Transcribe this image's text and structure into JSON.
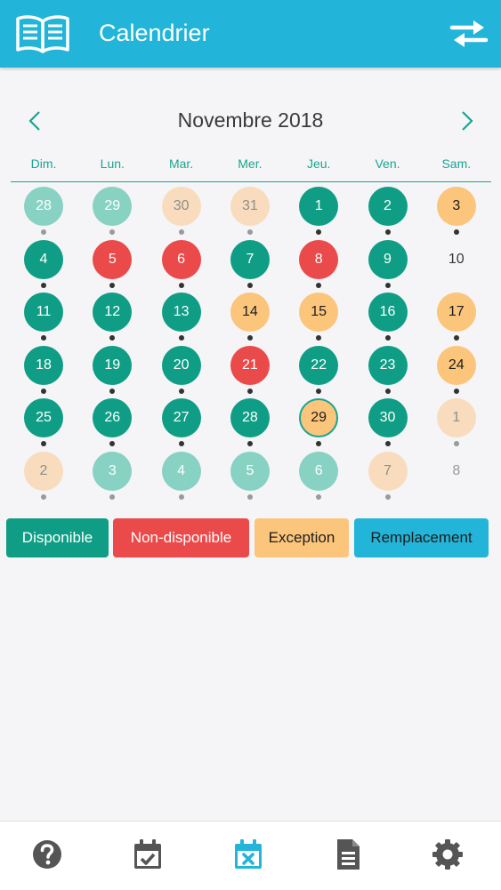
{
  "header": {
    "title": "Calendrier",
    "logo_icon": "open-book-icon",
    "action_icon": "swap-arrows-icon"
  },
  "calendar": {
    "month_title": "Novembre 2018",
    "prev_icon": "chevron-left-icon",
    "next_icon": "chevron-right-icon",
    "weekdays": [
      "Dim.",
      "Lun.",
      "Mar.",
      "Mer.",
      "Jeu.",
      "Ven.",
      "Sam."
    ],
    "weeks": [
      [
        {
          "day": "28",
          "status": "disp",
          "faded": true,
          "dot": true
        },
        {
          "day": "29",
          "status": "disp",
          "faded": true,
          "dot": true
        },
        {
          "day": "30",
          "status": "exc",
          "faded": true,
          "dot": true
        },
        {
          "day": "31",
          "status": "exc",
          "faded": true,
          "dot": true
        },
        {
          "day": "1",
          "status": "disp",
          "faded": false,
          "dot": true
        },
        {
          "day": "2",
          "status": "disp",
          "faded": false,
          "dot": true
        },
        {
          "day": "3",
          "status": "exc",
          "faded": false,
          "dot": true
        }
      ],
      [
        {
          "day": "4",
          "status": "disp",
          "faded": false,
          "dot": true
        },
        {
          "day": "5",
          "status": "indisp",
          "faded": false,
          "dot": true
        },
        {
          "day": "6",
          "status": "indisp",
          "faded": false,
          "dot": true
        },
        {
          "day": "7",
          "status": "disp",
          "faded": false,
          "dot": true
        },
        {
          "day": "8",
          "status": "indisp",
          "faded": false,
          "dot": true
        },
        {
          "day": "9",
          "status": "disp",
          "faded": false,
          "dot": true
        },
        {
          "day": "10",
          "status": "none",
          "faded": false,
          "dot": false
        }
      ],
      [
        {
          "day": "11",
          "status": "disp",
          "faded": false,
          "dot": true
        },
        {
          "day": "12",
          "status": "disp",
          "faded": false,
          "dot": true
        },
        {
          "day": "13",
          "status": "disp",
          "faded": false,
          "dot": true
        },
        {
          "day": "14",
          "status": "exc",
          "faded": false,
          "dot": true
        },
        {
          "day": "15",
          "status": "exc",
          "faded": false,
          "dot": true
        },
        {
          "day": "16",
          "status": "disp",
          "faded": false,
          "dot": true
        },
        {
          "day": "17",
          "status": "exc",
          "faded": false,
          "dot": true
        }
      ],
      [
        {
          "day": "18",
          "status": "disp",
          "faded": false,
          "dot": true
        },
        {
          "day": "19",
          "status": "disp",
          "faded": false,
          "dot": true
        },
        {
          "day": "20",
          "status": "disp",
          "faded": false,
          "dot": true
        },
        {
          "day": "21",
          "status": "indisp",
          "faded": false,
          "dot": true
        },
        {
          "day": "22",
          "status": "disp",
          "faded": false,
          "dot": true
        },
        {
          "day": "23",
          "status": "disp",
          "faded": false,
          "dot": true
        },
        {
          "day": "24",
          "status": "exc",
          "faded": false,
          "dot": true
        }
      ],
      [
        {
          "day": "25",
          "status": "disp",
          "faded": false,
          "dot": true
        },
        {
          "day": "26",
          "status": "disp",
          "faded": false,
          "dot": true
        },
        {
          "day": "27",
          "status": "disp",
          "faded": false,
          "dot": true
        },
        {
          "day": "28",
          "status": "disp",
          "faded": false,
          "dot": true
        },
        {
          "day": "29",
          "status": "exc",
          "faded": false,
          "dot": true,
          "today": true
        },
        {
          "day": "30",
          "status": "disp",
          "faded": false,
          "dot": true
        },
        {
          "day": "1",
          "status": "exc",
          "faded": true,
          "dot": true
        }
      ],
      [
        {
          "day": "2",
          "status": "exc",
          "faded": true,
          "dot": true
        },
        {
          "day": "3",
          "status": "disp",
          "faded": true,
          "dot": true
        },
        {
          "day": "4",
          "status": "disp",
          "faded": true,
          "dot": true
        },
        {
          "day": "5",
          "status": "disp",
          "faded": true,
          "dot": true
        },
        {
          "day": "6",
          "status": "disp",
          "faded": true,
          "dot": true
        },
        {
          "day": "7",
          "status": "exc",
          "faded": true,
          "dot": true
        },
        {
          "day": "8",
          "status": "none",
          "faded": true,
          "dot": false
        }
      ]
    ]
  },
  "legend": {
    "available": "Disponible",
    "unavailable": "Non-disponible",
    "exception": "Exception",
    "replacement": "Remplacement"
  },
  "colors": {
    "header": "#22b5d9",
    "available": "#0f9e85",
    "unavailable": "#eb4a4a",
    "exception": "#fcc57c",
    "replacement": "#22b5d9",
    "accent": "#1aa591",
    "tab_icon": "#555555",
    "tab_active": "#22b5d9"
  },
  "tabs": [
    {
      "icon": "help-icon",
      "active": false
    },
    {
      "icon": "calendar-check-icon",
      "active": false
    },
    {
      "icon": "calendar-cross-icon",
      "active": true
    },
    {
      "icon": "document-icon",
      "active": false
    },
    {
      "icon": "gear-icon",
      "active": false
    }
  ]
}
